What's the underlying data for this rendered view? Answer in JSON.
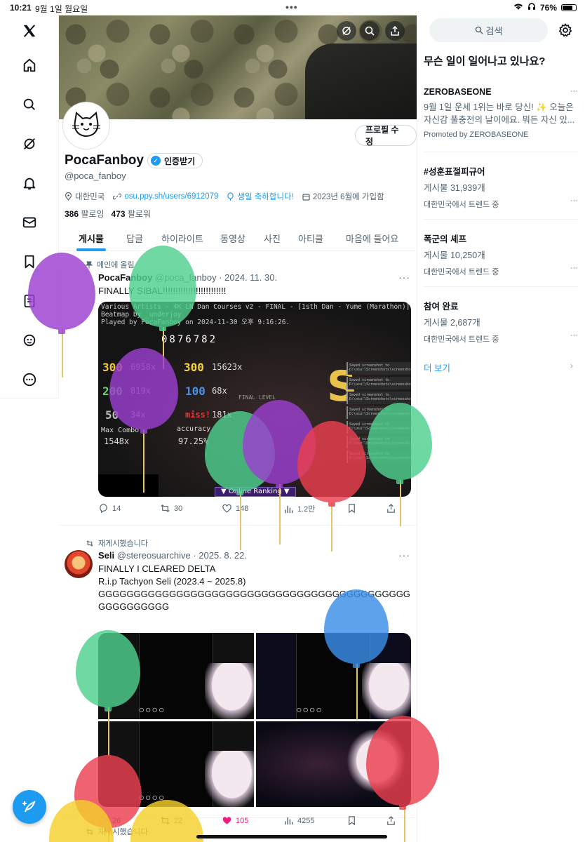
{
  "status": {
    "time": "10:21",
    "date": "9월 1일 월요일",
    "battery": "76%"
  },
  "nav": {
    "items": [
      "x-logo-icon",
      "home-icon",
      "search-icon",
      "grok-icon",
      "bell-icon",
      "mail-icon",
      "bookmark-icon",
      "list-icon",
      "communities-icon",
      "more-icon"
    ]
  },
  "profile": {
    "name": "PocaFanboy",
    "verify_label": "인증받기",
    "handle": "@poca_fanboy",
    "edit_label": "프로필 수정",
    "location": "대한민국",
    "link": "osu.ppy.sh/users/6912079",
    "birthday": "생일 축하합니다!",
    "joined": "2023년 6월에 가입함",
    "following_count": "386",
    "following_label": "팔로잉",
    "followers_count": "473",
    "followers_label": "팔로워"
  },
  "tabs": [
    "게시물",
    "답글",
    "하이라이트",
    "동영상",
    "사진",
    "아티클",
    "마음에 들어요"
  ],
  "posts": [
    {
      "context": "메인에 올림",
      "name": "PocaFanboy",
      "meta": "@poca_fanboy · 2024. 11. 30.",
      "text": "FINALLY SIBAL!!!!!!!!!!!!!!!!!!!!!!!!!",
      "media": {
        "title": "Various Artists - 4K LN Dan Courses v2 - FINAL - [1sth Dan - Yume (Marathon)]",
        "beatmap": "Beatmap by _underjoy",
        "played": "Played by PocaFanboy on 2024-11-30 오후 9:16:26.",
        "score": "0876782",
        "c300g": "300",
        "v300g": "6958x",
        "c300": "300",
        "v300": "15623x",
        "c200": "200",
        "v200": "819x",
        "c100": "100",
        "v100": "68x",
        "c50": "50",
        "v50": "34x",
        "cmiss": "miss!",
        "vmiss": "181x",
        "combo_label": "Max Combo",
        "combo": "1548x",
        "acc_label": "accuracy",
        "acc": "97.25%",
        "rank": "S",
        "final_level": "FINAL LEVEL",
        "online": "▼ Online Ranking ▼",
        "log_text": "Saved screenshot to D:\\osu!\\Screenshots\\screenshot.jpg"
      },
      "replies": "14",
      "reposts": "30",
      "likes": "148",
      "views": "1.2만"
    },
    {
      "context": "재게시했습니다",
      "name": "Seli",
      "meta": "@stereosuarchive · 2025. 8. 22.",
      "text_lines": [
        "FINALLY I CLEARED DELTA",
        "R.i.p Tachyon Seli (2023.4 ~ 2025.8)",
        "GGGGGGGGGGGGGGGGGGGGGGGGGGGGGGGGGGGGGGGGGGGGGGGGGGGGGG"
      ],
      "replies": "26",
      "reposts": "22",
      "likes": "105",
      "views": "4255"
    },
    {
      "context": "재게시했습니다"
    }
  ],
  "right": {
    "search_label": "검색",
    "title": "무슨 일이 일어나고 있나요?",
    "trends": [
      {
        "name": "ZEROBASEONE",
        "desc": "9월 1일 운세 1위는 바로 당신! ✨ 오늘은 자신감 풀충전의 날이에요. 뭐든 자신 있...",
        "meta": "Promoted by ZEROBASEONE"
      },
      {
        "name": "#성훈표절피규어",
        "desc": "게시물 31,939개",
        "meta": "대한민국에서 트렌드 중"
      },
      {
        "name": "폭군의 셰프",
        "desc": "게시물 10,250개",
        "meta": "대한민국에서 트렌드 중"
      },
      {
        "name": "참여 완료",
        "desc": "게시물 2,687개",
        "meta": "대한민국에서 트렌드 중"
      }
    ],
    "more_label": "더 보기"
  },
  "colors": {
    "accent": "#1d9bf0",
    "like": "#f91880"
  }
}
